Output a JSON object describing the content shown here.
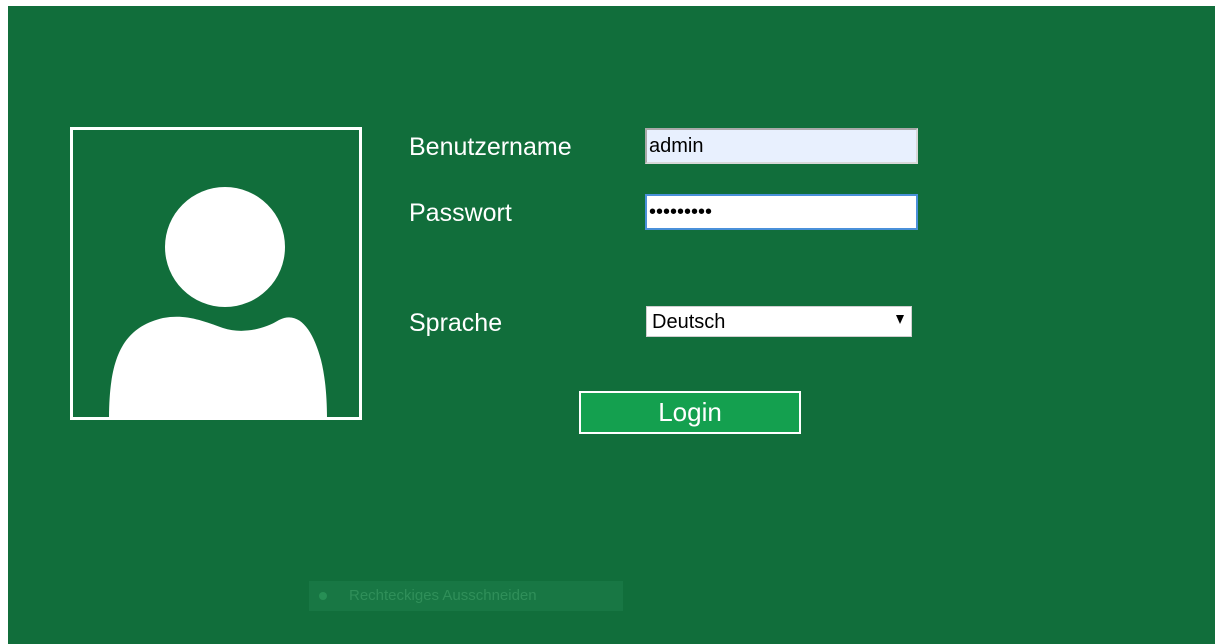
{
  "login": {
    "username_label": "Benutzername",
    "username_value": "admin",
    "password_label": "Passwort",
    "password_value": "•••••••••",
    "language_label": "Sprache",
    "language_value": "Deutsch",
    "login_button": "Login"
  },
  "overlay": {
    "snip_mode_label": "Rechteckiges Ausschneiden"
  },
  "colors": {
    "background": "#116e3b",
    "button": "#14a04f",
    "autofill_input": "#e8f0fe",
    "focus_border": "#4a90d9"
  },
  "icons": {
    "avatar": "user-silhouette-icon",
    "dropdown": "triangle-down-icon"
  }
}
